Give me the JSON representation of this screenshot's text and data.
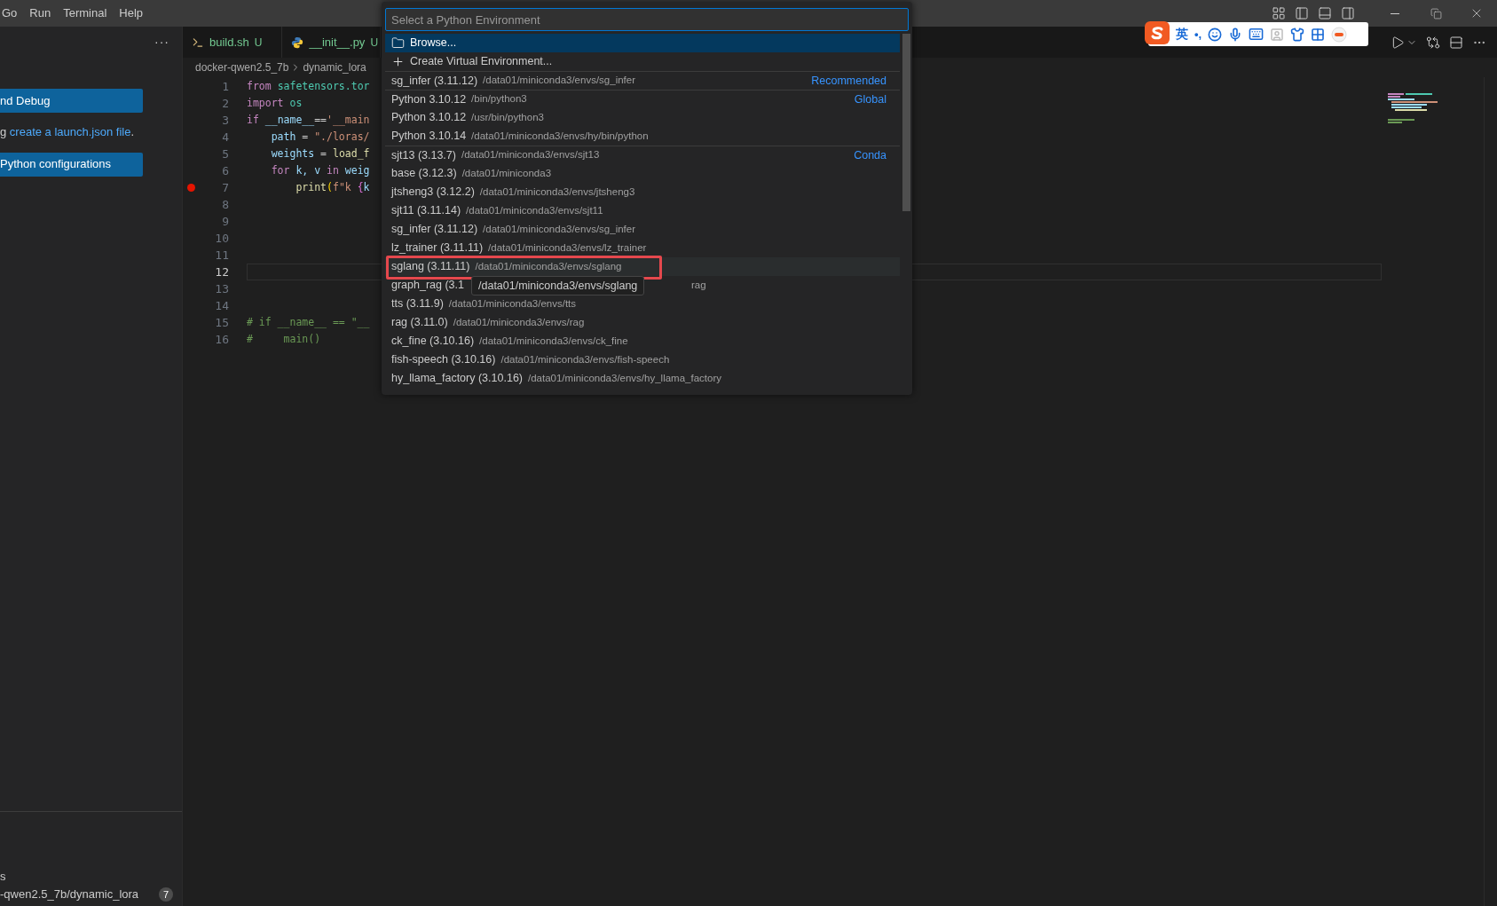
{
  "menu": [
    "Go",
    "Run",
    "Terminal",
    "Help"
  ],
  "sidebar": {
    "more": "···",
    "debug_button": "nd Debug",
    "hint_before": "g ",
    "hint_link": "create a launch.json file",
    "hint_after": ".",
    "config_button": "Python configurations",
    "bottom_label": "s",
    "bottom_path": "-qwen2.5_7b/dynamic_lora",
    "bottom_badge": "7"
  },
  "tabs": [
    {
      "kind": "shell",
      "label": "build.sh",
      "status": "U"
    },
    {
      "kind": "python",
      "label": "__init__.py",
      "status": "U"
    }
  ],
  "breadcrumb": [
    "docker-qwen2.5_7b",
    "dynamic_lora"
  ],
  "code": [
    {
      "number": "1",
      "tokens": [
        {
          "kind": "keyword",
          "text": "from"
        },
        {
          "kind": "module",
          "text": " safetensors.tor"
        }
      ]
    },
    {
      "number": "2",
      "tokens": [
        {
          "kind": "keyword",
          "text": "import"
        },
        {
          "kind": "module",
          "text": " os"
        }
      ]
    },
    {
      "number": "3",
      "tokens": [
        {
          "kind": "keyword",
          "text": "if"
        },
        {
          "kind": "var",
          "text": " __name__"
        },
        {
          "kind": "plain",
          "text": "=="
        },
        {
          "kind": "string",
          "text": "'__main"
        }
      ]
    },
    {
      "number": "4",
      "tokens": [
        {
          "kind": "var",
          "text": "    path"
        },
        {
          "kind": "plain",
          "text": " = "
        },
        {
          "kind": "string",
          "text": "\"./loras/"
        }
      ]
    },
    {
      "number": "5",
      "tokens": [
        {
          "kind": "var",
          "text": "    weights"
        },
        {
          "kind": "plain",
          "text": " = "
        },
        {
          "kind": "func",
          "text": "load_f"
        }
      ]
    },
    {
      "number": "6",
      "tokens": [
        {
          "kind": "keyword",
          "text": "    for"
        },
        {
          "kind": "var",
          "text": " k, v "
        },
        {
          "kind": "keyword",
          "text": "in"
        },
        {
          "kind": "var",
          "text": " weig"
        }
      ]
    },
    {
      "number": "7",
      "breakpoint": true,
      "tokens": [
        {
          "kind": "func",
          "text": "        print"
        },
        {
          "kind": "bracket",
          "text": "("
        },
        {
          "kind": "string",
          "text": "f\"k "
        },
        {
          "kind": "brace",
          "text": "{"
        },
        {
          "kind": "var",
          "text": "k"
        }
      ]
    },
    {
      "number": "8"
    },
    {
      "number": "9"
    },
    {
      "number": "10"
    },
    {
      "number": "11"
    },
    {
      "number": "12",
      "current": true
    },
    {
      "number": "13"
    },
    {
      "number": "14"
    },
    {
      "number": "15",
      "tokens": [
        {
          "kind": "comment",
          "text": "# if __name__ == \"__"
        }
      ]
    },
    {
      "number": "16",
      "tokens": [
        {
          "kind": "comment",
          "text": "#     main()"
        }
      ]
    }
  ],
  "ime_toolbar": {
    "language": "英",
    "punctuation": "•,"
  },
  "quick_pick": {
    "placeholder": "Select a Python Environment",
    "items": [
      {
        "kind": "browse",
        "label": "Browse...",
        "selected": true
      },
      {
        "kind": "create",
        "label": "Create Virtual Environment...",
        "selected": false
      },
      {
        "kind": "env",
        "label": "sg_infer (3.11.12)",
        "description": "/data01/miniconda3/envs/sg_infer",
        "tag": "Recommended",
        "separator": true,
        "selected": false
      },
      {
        "kind": "env",
        "label": "Python 3.10.12",
        "description": "/bin/python3",
        "tag": "Global",
        "separator": true,
        "selected": false
      },
      {
        "kind": "env",
        "label": "Python 3.10.12",
        "description": "/usr/bin/python3",
        "selected": false
      },
      {
        "kind": "env",
        "label": "Python 3.10.14",
        "description": "/data01/miniconda3/envs/hy/bin/python",
        "selected": false
      },
      {
        "kind": "env",
        "label": "sjt13 (3.13.7)",
        "description": "/data01/miniconda3/envs/sjt13",
        "tag": "Conda",
        "separator": true,
        "selected": false
      },
      {
        "kind": "env",
        "label": "base (3.12.3)",
        "description": "/data01/miniconda3",
        "selected": false
      },
      {
        "kind": "env",
        "label": "jtsheng3 (3.12.2)",
        "description": "/data01/miniconda3/envs/jtsheng3",
        "selected": false
      },
      {
        "kind": "env",
        "label": "sjt11 (3.11.14)",
        "description": "/data01/miniconda3/envs/sjt11",
        "selected": false
      },
      {
        "kind": "env",
        "label": "sg_infer (3.11.12)",
        "description": "/data01/miniconda3/envs/sg_infer",
        "selected": false
      },
      {
        "kind": "env",
        "label": "lz_trainer (3.11.11)",
        "description": "/data01/miniconda3/envs/lz_trainer",
        "selected": false
      },
      {
        "kind": "env",
        "label": "sglang (3.11.11)",
        "description": "/data01/miniconda3/envs/sglang",
        "hovered": true,
        "highlighted": true,
        "selected": false,
        "tooltip": "/data01/miniconda3/envs/sglang"
      },
      {
        "kind": "env",
        "label": "graph_rag (3.1",
        "description": "rag",
        "covered": true,
        "selected": false
      },
      {
        "kind": "env",
        "label": "tts (3.11.9)",
        "description": "/data01/miniconda3/envs/tts",
        "selected": false
      },
      {
        "kind": "env",
        "label": "rag (3.11.0)",
        "description": "/data01/miniconda3/envs/rag",
        "selected": false
      },
      {
        "kind": "env",
        "label": "ck_fine (3.10.16)",
        "description": "/data01/miniconda3/envs/ck_fine",
        "selected": false
      },
      {
        "kind": "env",
        "label": "fish-speech (3.10.16)",
        "description": "/data01/miniconda3/envs/fish-speech",
        "selected": false
      },
      {
        "kind": "env",
        "label": "hy_llama_factory (3.10.16)",
        "description": "/data01/miniconda3/envs/hy_llama_factory",
        "selected": false
      }
    ]
  }
}
